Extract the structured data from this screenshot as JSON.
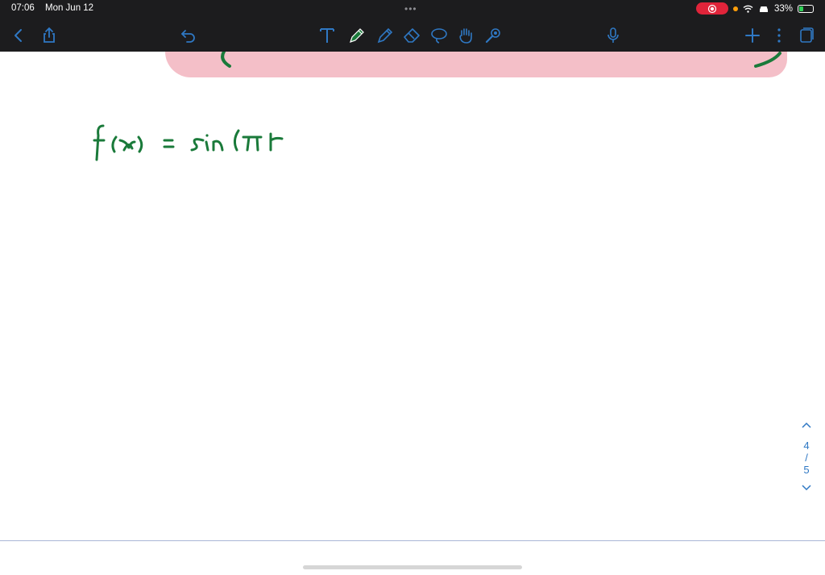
{
  "status_bar": {
    "time": "07:06",
    "date": "Mon Jun 12",
    "battery": "33%",
    "battery_level": 0.33
  },
  "toolbar": {
    "accent_color": "#2f78c4",
    "icons": [
      "back-icon",
      "share-icon",
      "undo-icon",
      "text-tool-icon",
      "pen-icon",
      "highlighter-icon",
      "eraser-icon",
      "lasso-icon",
      "hand-icon",
      "laser-pointer-icon",
      "microphone-icon",
      "add-page-icon",
      "more-icon",
      "pages-icon"
    ]
  },
  "canvas": {
    "ink_color": "#1a7a3a",
    "highlight_color": "#f4bfc8",
    "handwriting": "f(x) = sin(πr"
  },
  "pager": {
    "current_page": "4",
    "separator": "/",
    "total_pages": "5"
  }
}
